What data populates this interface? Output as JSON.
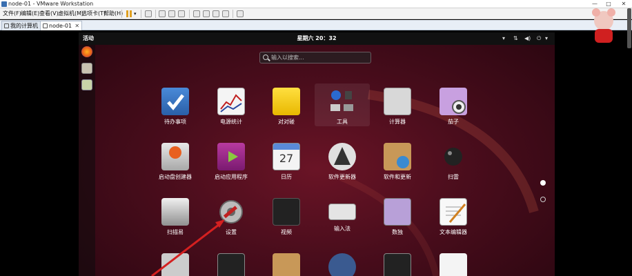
{
  "window": {
    "title": "node-01 - VMware Workstation"
  },
  "menubar": {
    "items": [
      "文件(F)",
      "编辑(E)",
      "查看(V)",
      "虚拟机(M)",
      "选项卡(T)",
      "帮助(H)"
    ]
  },
  "tabs": [
    {
      "label": "我的计算机"
    },
    {
      "label": "node-01",
      "active": true
    }
  ],
  "guest": {
    "topbar": {
      "activities": "活动",
      "clock": "星期六 20：32"
    },
    "search": {
      "placeholder": "输入以搜索..."
    },
    "apps": [
      {
        "label": "待办事项",
        "icon": "todo-icon"
      },
      {
        "label": "电源统计",
        "icon": "power-stats-icon"
      },
      {
        "label": "对对碰",
        "icon": "puzzle-game-icon"
      },
      {
        "label": "工具",
        "icon": "tools-folder-icon"
      },
      {
        "label": "计算器",
        "icon": "calculator-icon"
      },
      {
        "label": "茄子",
        "icon": "cheese-icon"
      },
      {
        "label": "启动盘创建器",
        "icon": "startup-disk-icon"
      },
      {
        "label": "启动应用程序",
        "icon": "startup-apps-icon"
      },
      {
        "label": "日历",
        "icon": "calendar-icon"
      },
      {
        "label": "软件更新器",
        "icon": "software-updater-icon"
      },
      {
        "label": "软件和更新",
        "icon": "software-updates-icon"
      },
      {
        "label": "扫雷",
        "icon": "mines-icon"
      },
      {
        "label": "扫描易",
        "icon": "scanner-icon"
      },
      {
        "label": "设置",
        "icon": "settings-icon"
      },
      {
        "label": "视频",
        "icon": "video-icon"
      },
      {
        "label": "输入法",
        "icon": "keyboard-icon"
      },
      {
        "label": "数独",
        "icon": "sudoku-icon"
      },
      {
        "label": "文本编辑器",
        "icon": "text-editor-icon"
      }
    ],
    "calendar_day": "27",
    "colors": {
      "accent_red": "#c81e1e",
      "bg_dark": "#2a0610"
    }
  }
}
